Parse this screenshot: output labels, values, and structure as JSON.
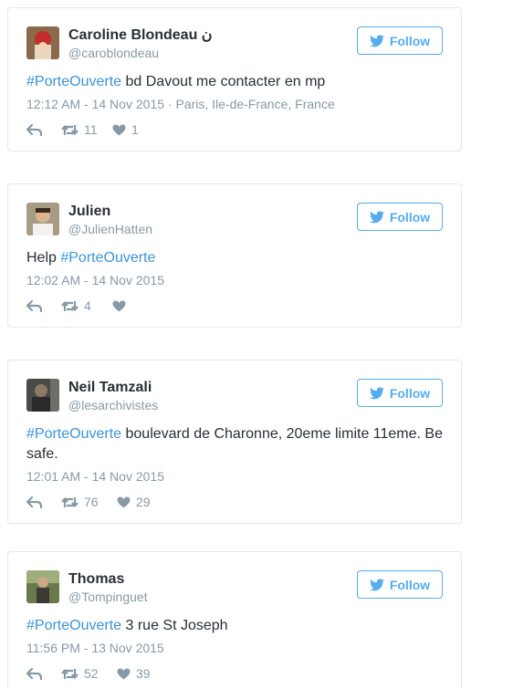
{
  "follow_label": "Follow",
  "colors": {
    "link": "#3b94d9",
    "follow": "#55acee",
    "muted": "#8899a6",
    "text": "#292f33",
    "border": "#e1e8ed"
  },
  "tweets": [
    {
      "name": "Caroline Blondeau ن",
      "handle": "@caroblondeau",
      "hashtag": "#PorteOuverte",
      "text": " bd Davout me contacter en mp",
      "timestamp": "12:12 AM - 14 Nov 2015",
      "location": " · Paris, Ile-de-France, France",
      "retweets": "11",
      "likes": "1"
    },
    {
      "name": "Julien",
      "handle": "@JulienHatten",
      "prefix": "Help ",
      "hashtag": "#PorteOuverte",
      "text": "",
      "timestamp": "12:02 AM - 14 Nov 2015",
      "location": "",
      "retweets": "4",
      "likes": ""
    },
    {
      "name": "Neil Tamzali",
      "handle": "@lesarchivistes",
      "hashtag": "#PorteOuverte",
      "text": " boulevard de Charonne, 20eme limite 11eme. Be safe.",
      "timestamp": "12:01 AM - 14 Nov 2015",
      "location": "",
      "retweets": "76",
      "likes": "29"
    },
    {
      "name": "Thomas",
      "handle": "@Tompinguet",
      "hashtag": "#PorteOuverte",
      "text": " 3 rue St Joseph",
      "timestamp": "11:56 PM - 13 Nov 2015",
      "location": "",
      "retweets": "52",
      "likes": "39"
    }
  ]
}
